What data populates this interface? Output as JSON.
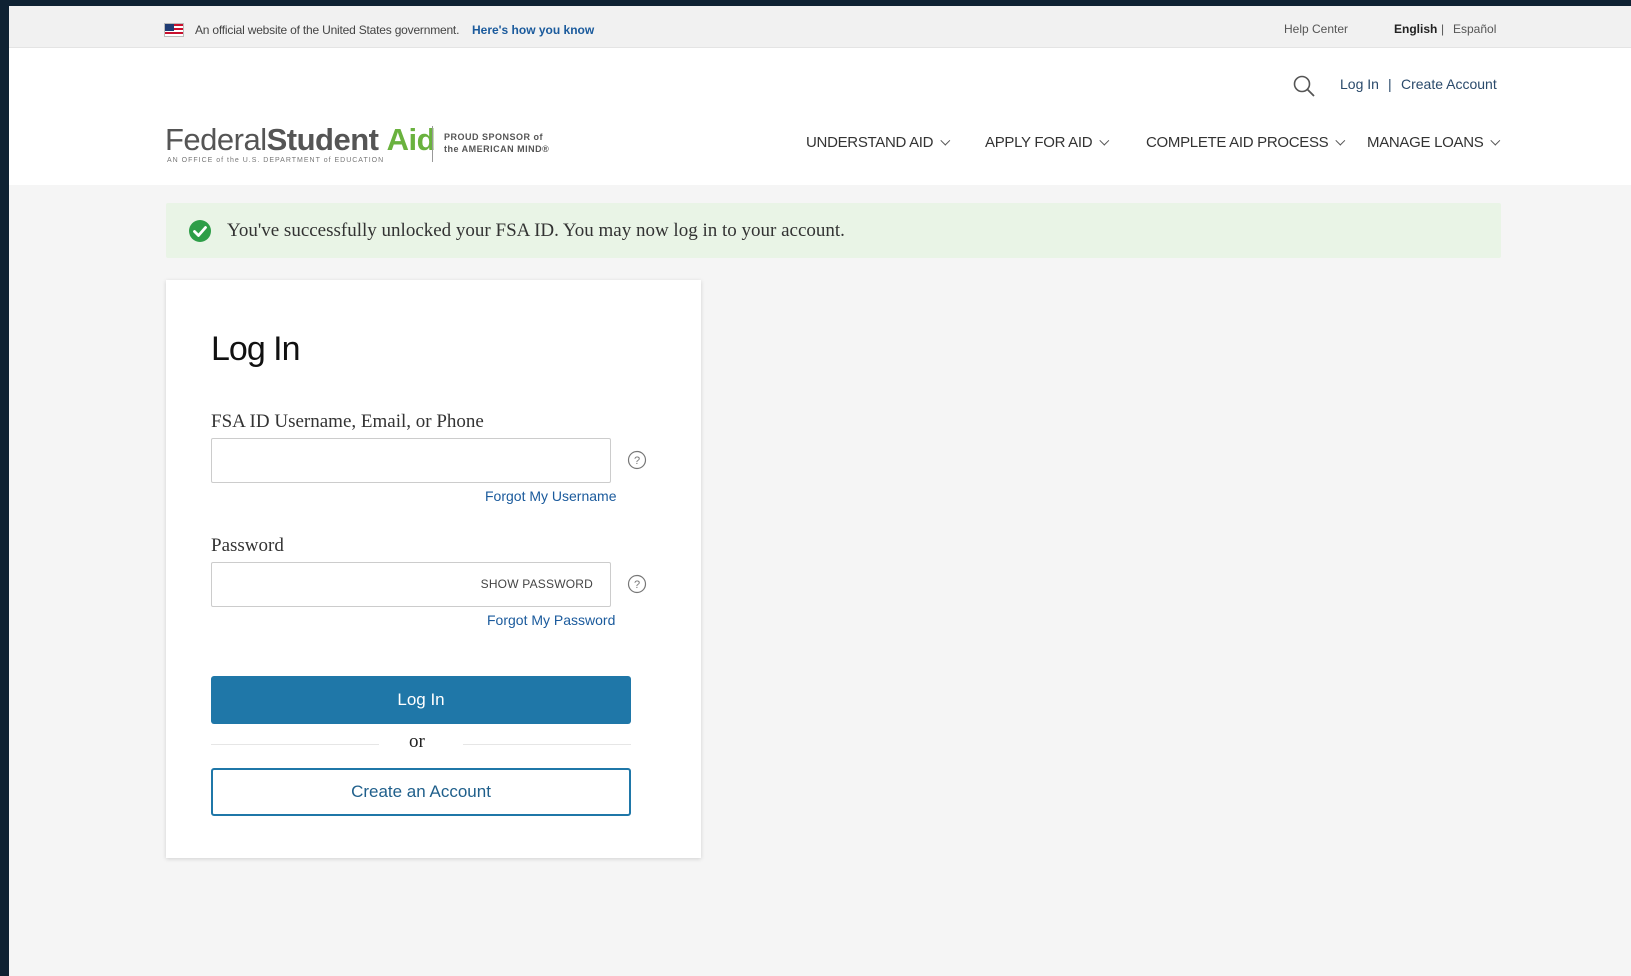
{
  "gov_banner": {
    "official_text": "An official website of the United States government.",
    "how_you_know": "Here's how you know",
    "help_center": "Help Center",
    "lang_english": "English",
    "lang_separator": "|",
    "lang_spanish": "Español"
  },
  "header": {
    "login_link": "Log In",
    "separator": "|",
    "create_account_link": "Create Account",
    "logo": {
      "federal": "Federal",
      "student": "Student",
      "aid": "Aid",
      "subtitle": "AN OFFICE of the U.S. DEPARTMENT of EDUCATION",
      "sponsor_line1": "PROUD SPONSOR of",
      "sponsor_line2": "the AMERICAN MIND®"
    },
    "nav": [
      "UNDERSTAND AID",
      "APPLY FOR AID",
      "COMPLETE AID PROCESS",
      "MANAGE LOANS"
    ]
  },
  "alert": {
    "message": "You've successfully unlocked your FSA ID. You may now log in to your account.",
    "color": "#e9f4e6"
  },
  "login_form": {
    "title": "Log In",
    "username_label": "FSA ID Username, Email, or Phone",
    "username_value": "",
    "forgot_username": "Forgot My Username",
    "password_label": "Password",
    "password_value": "",
    "show_password": "SHOW PASSWORD",
    "forgot_password": "Forgot My Password",
    "login_button": "Log In",
    "or_text": "or",
    "create_button": "Create an Account"
  },
  "colors": {
    "primary": "#1f77a8",
    "link": "#1a5a9c",
    "logo_green": "#6ab23e",
    "success_green": "#2e9e48"
  }
}
